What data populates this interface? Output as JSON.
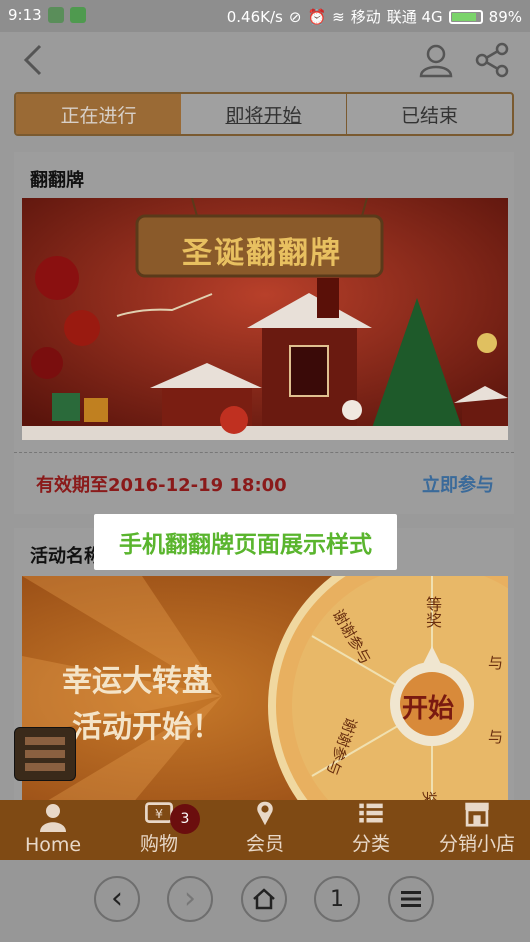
{
  "status_bar": {
    "time": "9:13",
    "speed": "0.46K/s",
    "carrier1": "移动",
    "carrier2": "联通 4G",
    "battery": "89%",
    "battery_level": 0.89
  },
  "nav": {
    "back_icon": "chevron-left-icon",
    "user_icon": "user-icon",
    "share_icon": "share-icon"
  },
  "tabs": [
    {
      "label": "正在进行",
      "active": true
    },
    {
      "label": "即将开始",
      "active": false
    },
    {
      "label": "已结束",
      "active": false
    }
  ],
  "activity1": {
    "title": "翻翻牌",
    "banner_text": "圣诞翻翻牌",
    "valid_until": "有效期至2016-12-19 18:00",
    "join": "立即参与"
  },
  "activity2": {
    "title": "活动名称",
    "banner_line1": "幸运大转盘",
    "banner_line2": "活动开始！",
    "start": "开始",
    "wheel_labels": [
      "等奖",
      "谢谢参与",
      "谢谢参与",
      "与",
      "与",
      "奖"
    ]
  },
  "overlay": {
    "caption": "手机翻翻牌页面展示样式"
  },
  "bottom_nav": [
    {
      "label": "Home",
      "icon": "home-person-icon"
    },
    {
      "label": "购物",
      "icon": "cart-icon",
      "badge": "3"
    },
    {
      "label": "会员",
      "icon": "member-pin-icon"
    },
    {
      "label": "分类",
      "icon": "list-icon"
    },
    {
      "label": "分销小店",
      "icon": "shop-icon"
    }
  ],
  "browser_bar": {
    "back": "‹",
    "forward": "›",
    "home_icon": "home-icon",
    "tabs_count": "1",
    "menu_icon": "menu-icon"
  },
  "colors": {
    "accent": "#9a6a35",
    "bottom_nav_bg": "#7f4a14",
    "caption_green": "#5ab52e",
    "date_red": "#8a1a1a",
    "link_blue": "#3a6a9a"
  }
}
